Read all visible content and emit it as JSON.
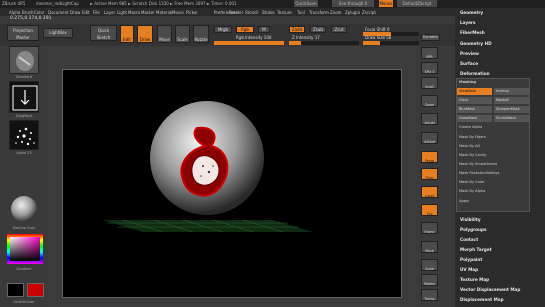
{
  "titlebar": {
    "app": "ZBrush 4R5",
    "doc": "mesmer_redLightCap",
    "stats": "► Active Mem 985 ► Scratch Disk 1330 ► Free Mem 3097 ► Timer: 0.001",
    "quicksave": "QuickSave",
    "see_through": "See-through  0",
    "menus": "Menus",
    "script": "DefaultZScript"
  },
  "menubar": [
    "Alpha",
    "Brush",
    "Color",
    "Document",
    "Draw",
    "Edit",
    "File",
    "Layer",
    "Light",
    "Macro",
    "Marker",
    "Material",
    "Movie",
    "Picker",
    "Preferences",
    "Render",
    "Stencil",
    "Stroke",
    "Texture",
    "Tool",
    "Transform",
    "Zoom",
    "Zplugin",
    "Zscript"
  ],
  "coord": "0.275,0.174,0.191",
  "toolbar": {
    "projection_master": "Projection Master",
    "lightbox": "LightBox",
    "quick_sketch": "Quick Sketch",
    "edit": "Edit",
    "draw": "Draw",
    "move": "Move",
    "scale": "Scale",
    "rotate": "Rotate",
    "mrgb": "Mrgb",
    "rgb": "Rgb",
    "m": "M",
    "zadd": "Zadd",
    "zsub": "Zsub",
    "zcut": "Zcut",
    "rgb_intensity": "Rgb Intensity 100",
    "z_intensity": "Z Intensity 17",
    "focal_shift": "Focal Shift 0",
    "draw_size": "Draw Size 56",
    "dynamic": "Dynamic"
  },
  "leftshelf": {
    "standard": "Standard",
    "dragrect": "DragRect",
    "alpha": "Alpha 23",
    "material": "MatCap Gray",
    "gradient": "Gradient",
    "switch_color": "SwitchColor"
  },
  "rightshelf": [
    "BPR",
    "SPix 3",
    "Scroll",
    "Zoom",
    "Actual",
    "AAHalf",
    "Persp",
    "Floor",
    "Local",
    "Xyz",
    "Frame",
    "Move",
    "Scale",
    "Rotate",
    "Transp",
    "Ghost",
    "Solo",
    "Xpose"
  ],
  "tray": {
    "top_items": [
      "Geometry",
      "Layers",
      "FiberMesh",
      "Geometry HD",
      "Preview",
      "Surface",
      "Deformation",
      "Masking"
    ],
    "bottom_items": [
      "Visibility",
      "Polygroups",
      "Contact",
      "Morph Target",
      "Polypaint",
      "UV Map",
      "Texture Map",
      "Vector Displacement Map",
      "Displacement Map"
    ]
  },
  "masking": {
    "buttons": [
      [
        "ViewMask",
        "Inverse"
      ],
      [
        "Clear",
        "MaskAll"
      ],
      [
        "BlurMask",
        "SharpenMask"
      ],
      [
        "GrowMask",
        "ShrinkMask"
      ]
    ],
    "rows": [
      "Create Alpha",
      "Mask By Fibers",
      "Mask By AO",
      "Mask By Cavity",
      "Mask By Smoothness",
      "Mask PeaksAndValleys",
      "Mask By Color",
      "Mask By Alpha",
      "Apply"
    ]
  },
  "colors": {
    "accent": "#e67e22",
    "primary": "#000000",
    "secondary": "#cc0000"
  }
}
